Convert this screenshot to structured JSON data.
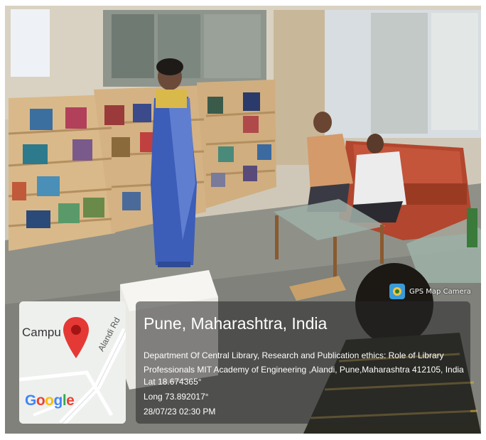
{
  "overlay": {
    "app_label": "GPS Map Camera",
    "app_icon": "gps-map-camera-icon",
    "accent_color": "#3a9bd8"
  },
  "map": {
    "place_label": "Campu",
    "road_label": "Alandi Rd",
    "brand": "Google",
    "pin_color": "#e53935"
  },
  "location": {
    "city": "Pune, Maharashtra, India",
    "address": "Department Of Central Library, Research and Publication ethics: Role of Library Professionals MIT Academy of Engineering ,Alandi, Pune,Maharashtra 412105, India",
    "lat": "Lat 18.674365°",
    "long": "Long 73.892017°",
    "datetime": "28/07/23 02:30 PM"
  }
}
